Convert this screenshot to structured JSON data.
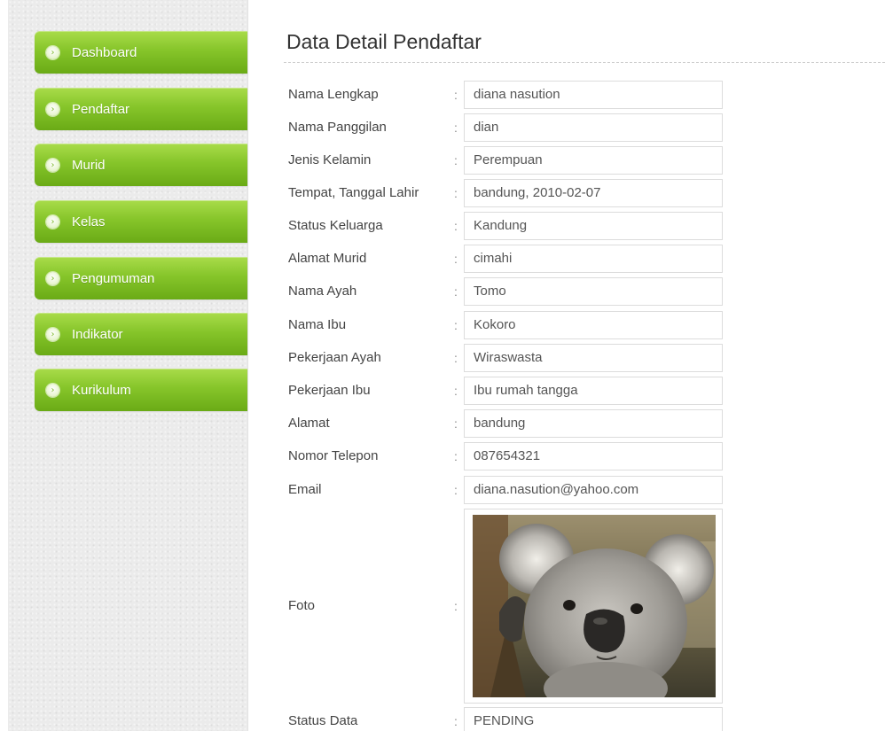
{
  "sidebar": {
    "items": [
      {
        "label": "Dashboard"
      },
      {
        "label": "Pendaftar"
      },
      {
        "label": "Murid"
      },
      {
        "label": "Kelas"
      },
      {
        "label": "Pengumuman"
      },
      {
        "label": "Indikator"
      },
      {
        "label": "Kurikulum"
      }
    ]
  },
  "main": {
    "title": "Data Detail Pendaftar",
    "separator": ":",
    "fields": [
      {
        "label": "Nama Lengkap",
        "value": "diana nasution"
      },
      {
        "label": "Nama Panggilan",
        "value": "dian"
      },
      {
        "label": "Jenis Kelamin",
        "value": "Perempuan"
      },
      {
        "label": "Tempat, Tanggal Lahir",
        "value": "bandung, 2010-02-07"
      },
      {
        "label": "Status Keluarga",
        "value": "Kandung"
      },
      {
        "label": "Alamat Murid",
        "value": "cimahi"
      },
      {
        "label": "Nama Ayah",
        "value": "Tomo"
      },
      {
        "label": "Nama Ibu",
        "value": "Kokoro"
      },
      {
        "label": "Pekerjaan Ayah",
        "value": "Wiraswasta"
      },
      {
        "label": "Pekerjaan Ibu",
        "value": "Ibu rumah tangga"
      },
      {
        "label": "Alamat",
        "value": "bandung"
      },
      {
        "label": "Nomor Telepon",
        "value": "087654321"
      },
      {
        "label": "Email",
        "value": "diana.nasution@yahoo.com"
      }
    ],
    "photo": {
      "label": "Foto"
    },
    "status": {
      "label": "Status Data",
      "value": "PENDING"
    }
  },
  "colors": {
    "nav_green_top": "#a9dc4a",
    "nav_green_bottom": "#6aab16",
    "sidebar_bg": "#ebebeb"
  }
}
